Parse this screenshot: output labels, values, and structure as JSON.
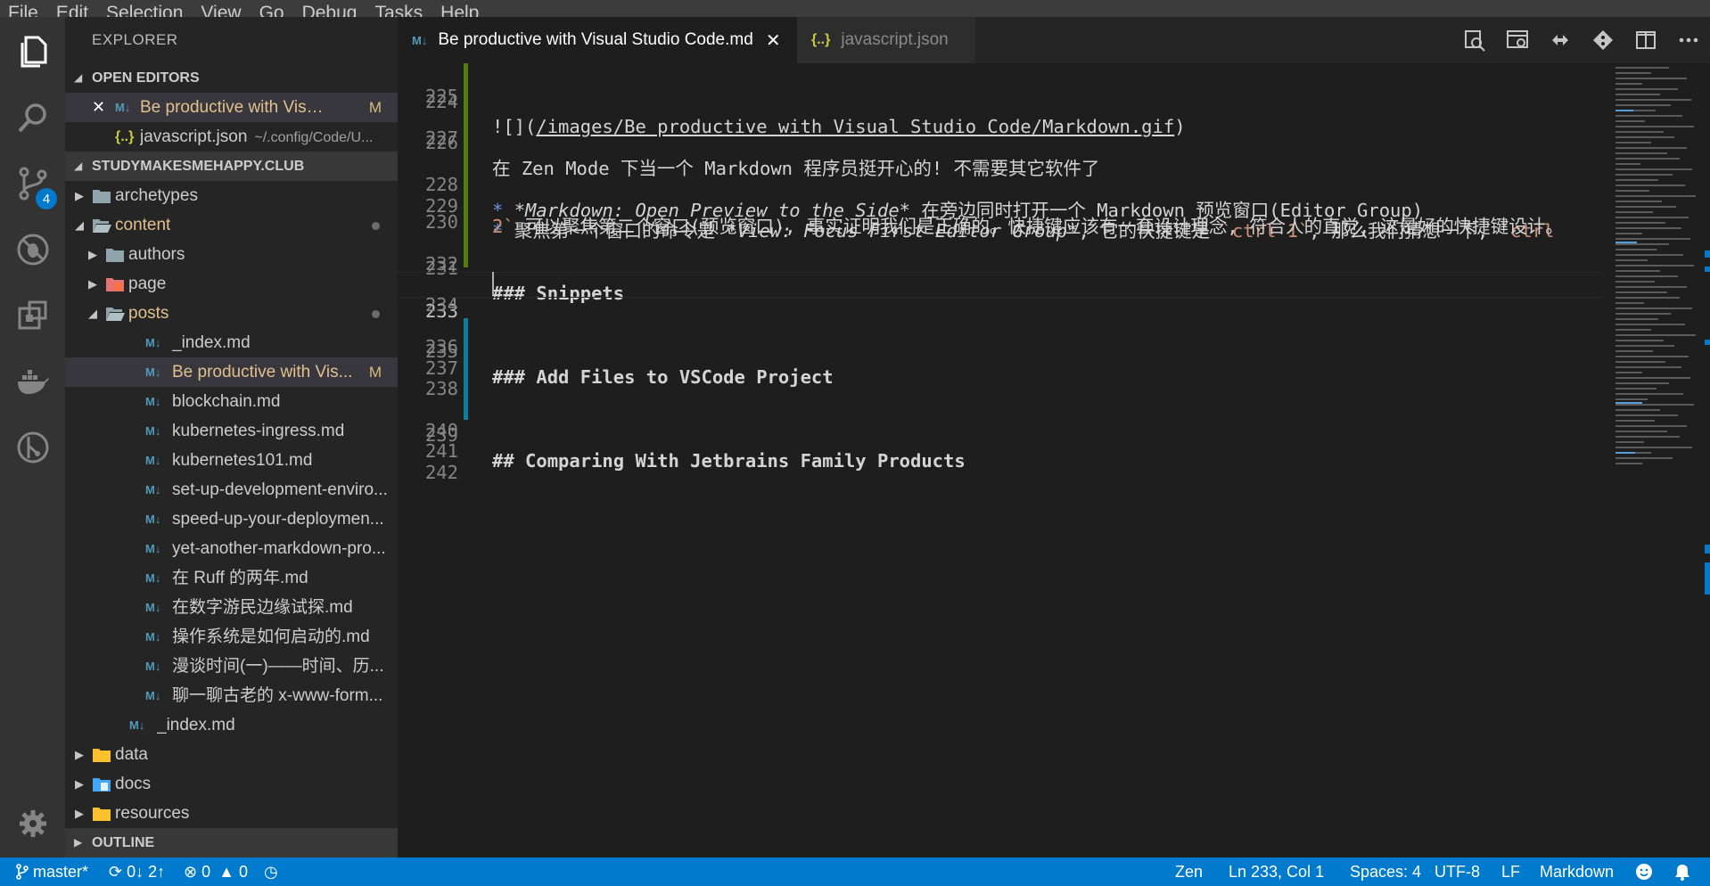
{
  "menu": [
    "File",
    "Edit",
    "Selection",
    "View",
    "Go",
    "Debug",
    "Tasks",
    "Help"
  ],
  "activity": {
    "scm_badge": "4"
  },
  "sidebar": {
    "title": "EXPLORER",
    "open_editors_header": "OPEN EDITORS",
    "open_editors": [
      {
        "label": "Be productive with Visual ...",
        "flag": "M",
        "icon": "markdown-icon"
      },
      {
        "label": "javascript.json",
        "desc": "~/.config/Code/U...",
        "icon": "json-icon"
      }
    ],
    "workspace_header": "STUDYMAKESMEHAPPY.CLUB",
    "tree": {
      "archetypes": "archetypes",
      "content": "content",
      "authors": "authors",
      "page": "page",
      "posts": "posts",
      "posts_files": [
        "_index.md",
        "Be productive with Vis...",
        "blockchain.md",
        "kubernetes-ingress.md",
        "kubernetes101.md",
        "set-up-development-enviro...",
        "speed-up-your-deploymen...",
        "yet-another-markdown-pro...",
        "在 Ruff 的两年.md",
        "在数字游民边缘试探.md",
        "操作系统是如何启动的.md",
        "漫谈时间(一)——时间、历...",
        "聊一聊古老的 x-www-form..."
      ],
      "selected_flag": "M",
      "content_index": "_index.md",
      "data": "data",
      "docs": "docs",
      "resources": "resources"
    },
    "outline_header": "OUTLINE"
  },
  "tabs": {
    "active": "Be productive with Visual Studio Code.md",
    "inactive": "javascript.json"
  },
  "editor": {
    "line_numbers": [
      "224",
      "225",
      "226",
      "227",
      "228",
      "229",
      "230",
      "231",
      "232",
      "233",
      "234",
      "235",
      "236",
      "237",
      "238",
      "239",
      "240",
      "241",
      "242"
    ],
    "l224_prefix": "![](",
    "l224_link": "/images/Be productive with Visual Studio Code/Markdown.gif",
    "l224_suffix": ")",
    "l226": "在 Zen Mode 下当一个 Markdown 程序员挺开心的! 不需要其它软件了",
    "l228_bullet": "*",
    "l228_italic": "*Markdown: Open Preview to the Side*",
    "l228_rest": " 在旁边同时打开一个 Markdown 预览窗口(Editor Group)",
    "l229_bullet": "*",
    "l229_a": "聚焦第一个窗口的命令是 ",
    "l229_italic": "*View: Focus First Editor Group*",
    "l229_b": ", 它的快捷键是 ",
    "l229_code1": "`ctrl 1`",
    "l229_c": ", 那么我们猜想一下, ",
    "l229_code2a": "`ctrl",
    "l229_code2b": "2`",
    "l229_d": " 可以聚焦第二个窗口(预览窗口), 事实证明我们是正确的。快捷键应该有一套设计理念, 符合人的直觉, 这是好的快捷键设计。",
    "h231": "### Snippets",
    "h235": "### Add Files to VSCode Project",
    "h239": "## Comparing With Jetbrains Family Products"
  },
  "status": {
    "branch": "master*",
    "sync": "0↓ 2↑",
    "errors": "0",
    "warnings": "0",
    "zen": "Zen",
    "position": "Ln 233, Col 1",
    "spaces": "Spaces: 4",
    "encoding": "UTF-8",
    "eol": "LF",
    "language": "Markdown"
  },
  "colors": {
    "statusbar": "#007acc",
    "heading": "#569cd6",
    "modified": "#e2c08d",
    "gutter_added": "#587c0c",
    "gutter_modified": "#0c7d9d"
  }
}
